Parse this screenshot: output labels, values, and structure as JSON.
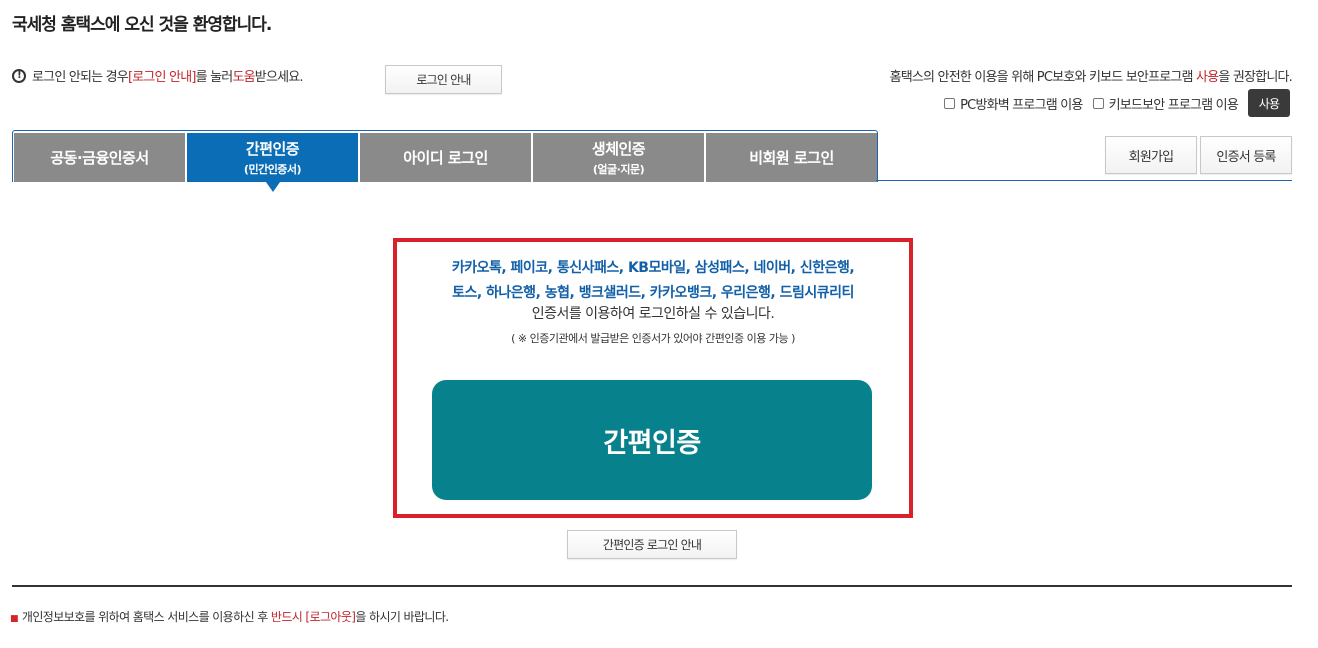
{
  "header": {
    "title": "국세청 홈택스에 오신 것을 환영합니다."
  },
  "notice": {
    "part1": "로그인 안되는 경우 ",
    "highlight1": "[로그인 안내]",
    "part2": "를 눌러 ",
    "highlight2": "도움",
    "part3": "받으세요.",
    "button_label": "로그인 안내"
  },
  "security": {
    "text_part1": "홈택스의 안전한 이용을 위해 PC보호와 키보드 보안프로그램 ",
    "text_highlight": "사용",
    "text_part2": "을 권장합니다.",
    "firewall_label": "PC방화벽 프로그램 이용",
    "keyboard_label": "키보드보안 프로그램 이용",
    "use_button": "사용"
  },
  "tabs": [
    {
      "label": "공동·금융인증서",
      "sub": "",
      "active": false
    },
    {
      "label": "간편인증",
      "sub": "(민간인증서)",
      "active": true
    },
    {
      "label": "아이디 로그인",
      "sub": "",
      "active": false
    },
    {
      "label": "생체인증",
      "sub": "(얼굴·지문)",
      "active": false
    },
    {
      "label": "비회원 로그인",
      "sub": "",
      "active": false
    }
  ],
  "side_buttons": {
    "join": "회원가입",
    "cert_register": "인증서 등록"
  },
  "simple_auth": {
    "providers_line1": "카카오톡, 페이코, 통신사패스, KB모바일, 삼성패스, 네이버, 신한은행,",
    "providers_line2": "토스, 하나은행, 농협, 뱅크샐러드, 카카오뱅크, 우리은행, 드림시큐리티",
    "description": "인증서를 이용하여 로그인하실 수 있습니다.",
    "note": "( ※ 인증기관에서 발급받은 인증서가 있어야 간편인증 이용 가능 )",
    "main_button": "간편인증",
    "guide_button": "간편인증 로그인 안내"
  },
  "footer": {
    "part1": "개인정보보호를 위하여 홈택스 서비스를 이용하신 후 ",
    "highlight": "반드시 [로그아웃]",
    "part2": "을 하시기 바랍니다."
  }
}
